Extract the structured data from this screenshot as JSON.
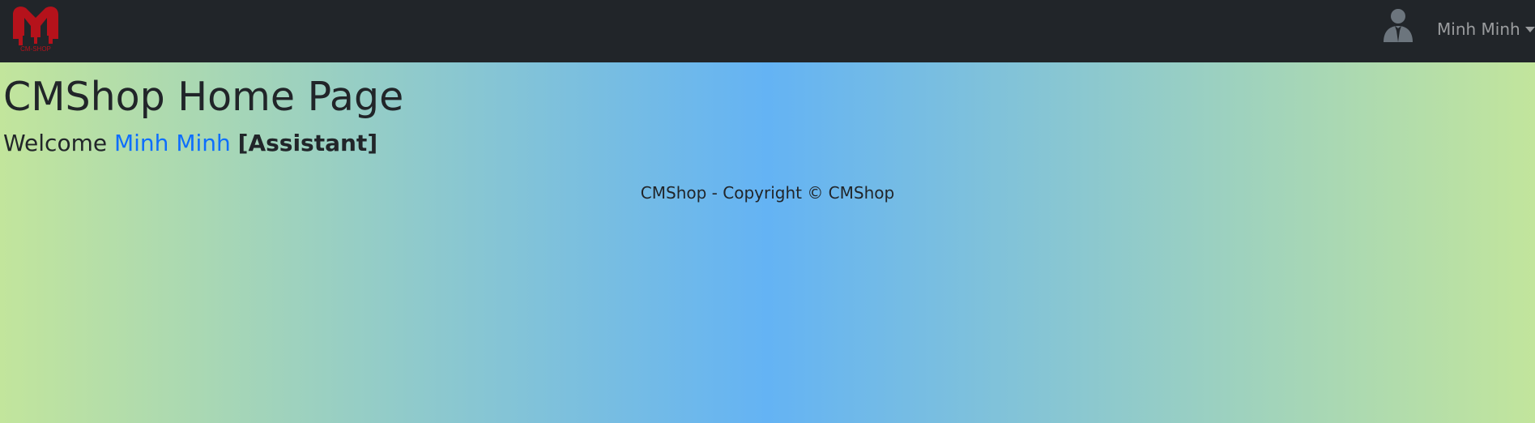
{
  "navbar": {
    "logo_text": "CM-SHOP",
    "user_name": "Minh Minh"
  },
  "main": {
    "title": "CMShop Home Page",
    "welcome_label": "Welcome",
    "user_link": "Minh Minh",
    "role": "[Assistant]"
  },
  "footer": {
    "text": "CMShop - Copyright © CMShop"
  },
  "colors": {
    "navbar_bg": "#212529",
    "link": "#0d6efd",
    "gradient_edge": "#c2e59c",
    "gradient_center": "#64b3f4",
    "logo": "#b5121b"
  }
}
